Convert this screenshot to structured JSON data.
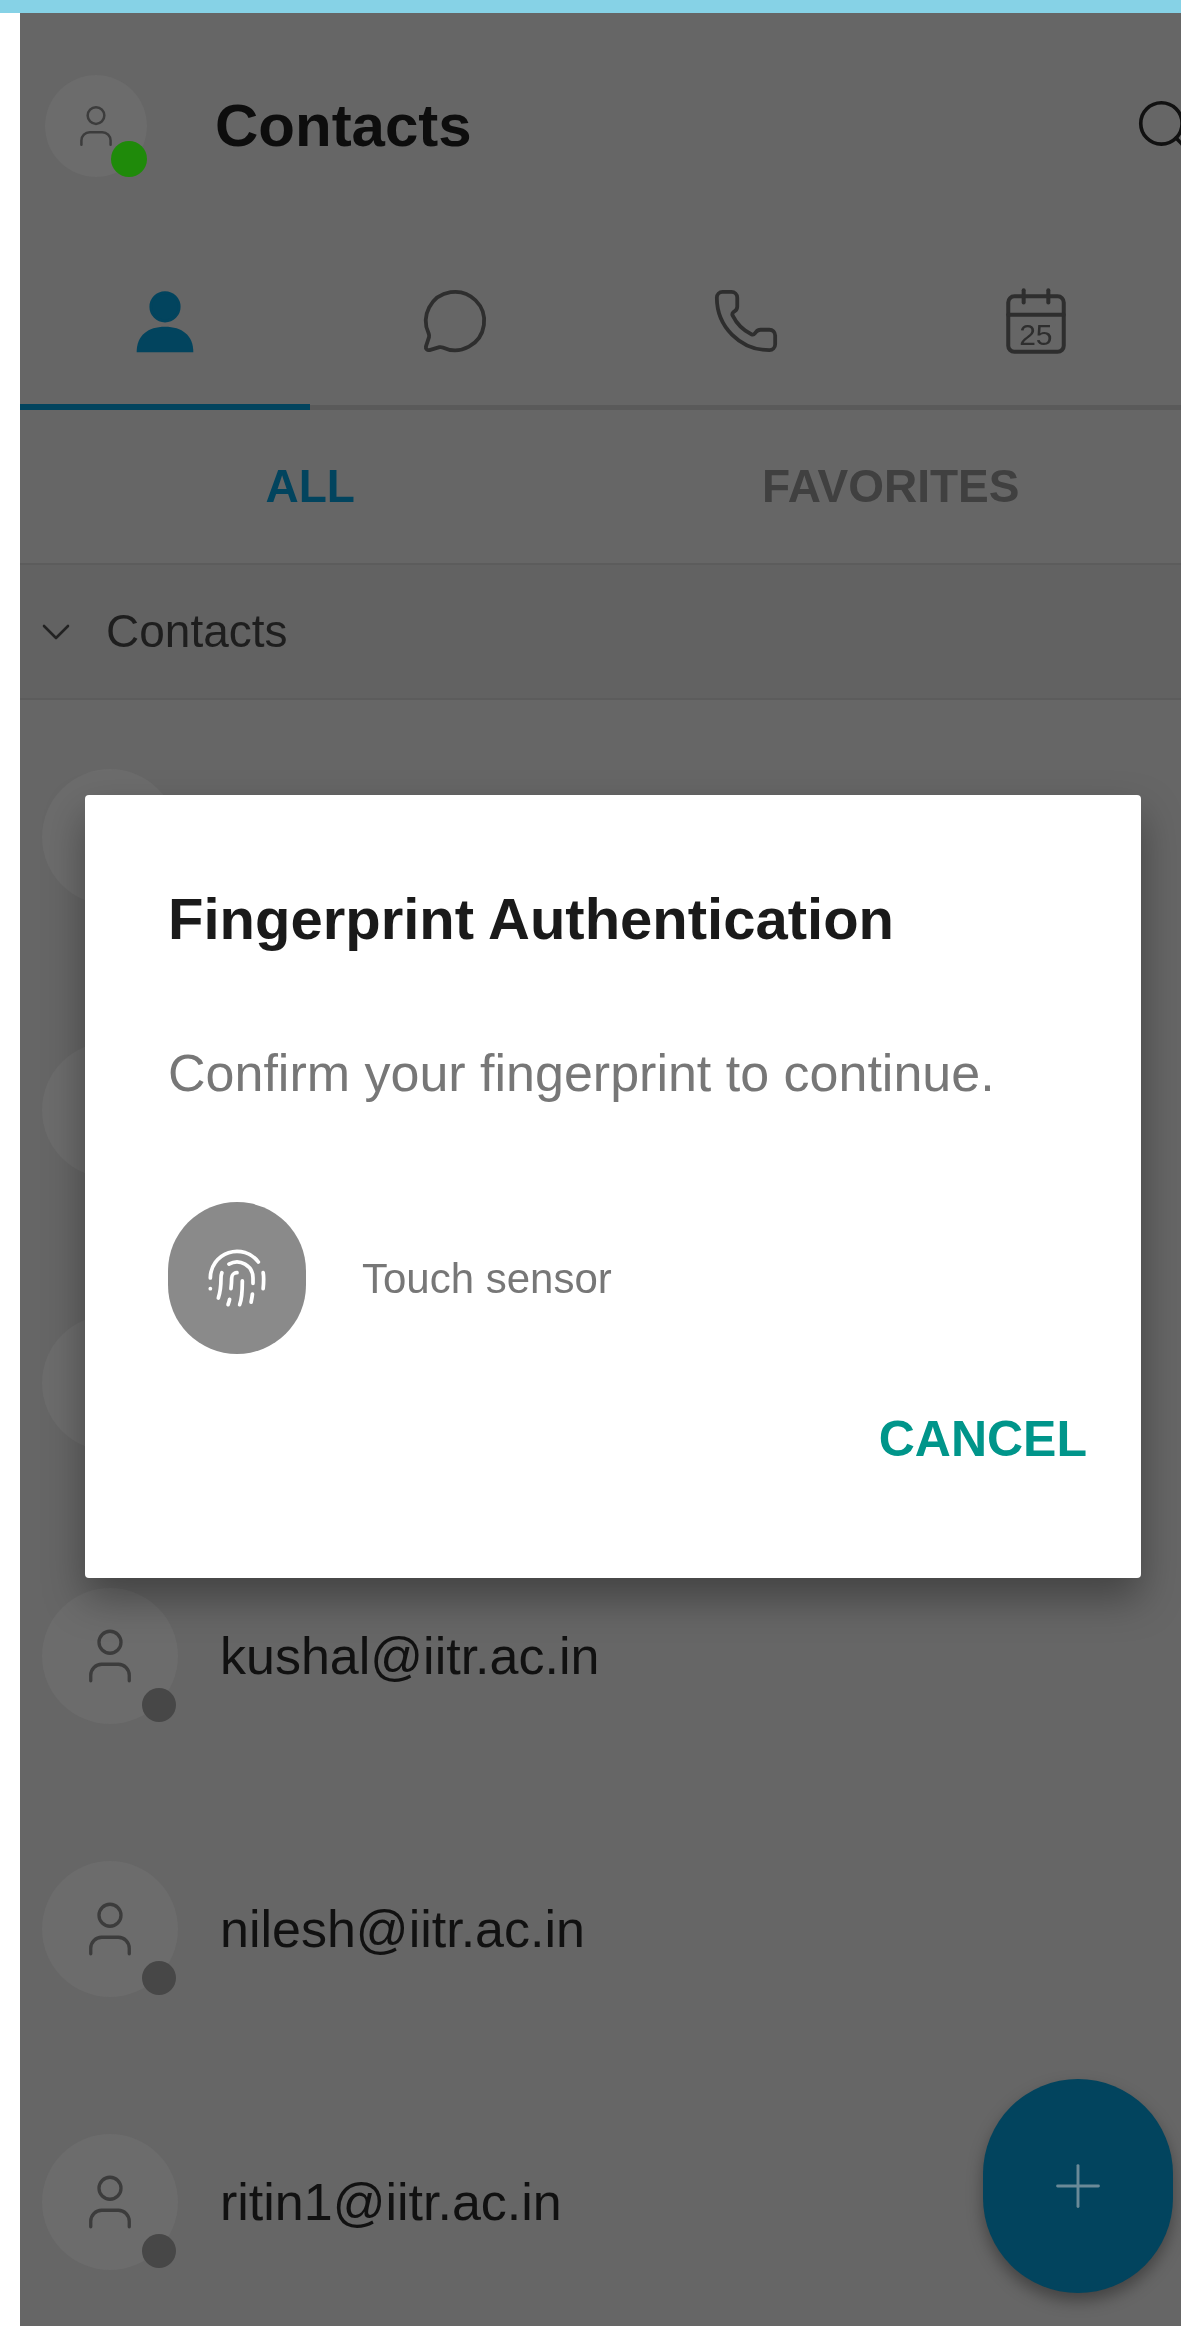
{
  "app_bar": {
    "title": "Contacts",
    "online": true
  },
  "tabs": [
    {
      "kind": "person",
      "selected": true
    },
    {
      "kind": "chat",
      "selected": false
    },
    {
      "kind": "phone",
      "selected": false
    },
    {
      "kind": "calendar",
      "label": "25",
      "selected": false
    }
  ],
  "subtabs": [
    {
      "label": "ALL",
      "selected": true
    },
    {
      "label": "FAVORITES",
      "selected": false
    }
  ],
  "section": {
    "label": "Contacts",
    "expanded": true
  },
  "contacts": [
    {
      "kind": "obscured"
    },
    {
      "kind": "obscured"
    },
    {
      "kind": "obscured"
    },
    {
      "kind": "visible",
      "name": "kushal@iitr.ac.in",
      "color": "#474747"
    },
    {
      "kind": "visible",
      "name": "nilesh@iitr.ac.in",
      "color": "#474747"
    },
    {
      "kind": "visible",
      "name": "ritin1@iitr.ac.in",
      "color": "#474747"
    }
  ],
  "dialog": {
    "title": "Fingerprint Authentication",
    "message": "Confirm your fingerprint to continue.",
    "sensor_label": "Touch sensor",
    "action": "CANCEL"
  }
}
